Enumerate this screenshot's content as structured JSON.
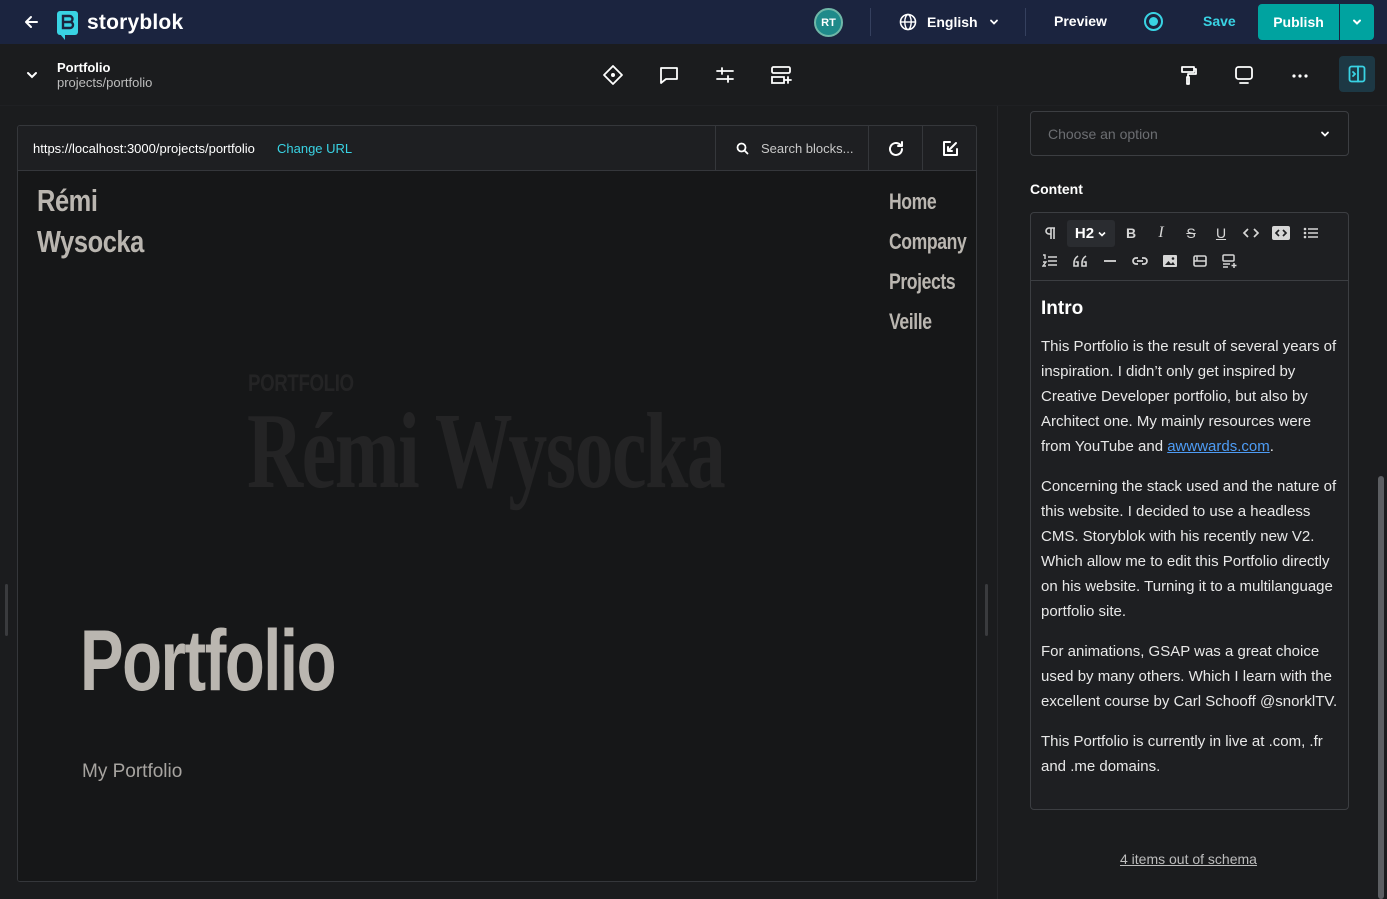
{
  "app": {
    "brand": "storyblok",
    "colors": {
      "topbar": "#1b243f",
      "accent": "#39d3e4",
      "publish": "#00a3a0",
      "link": "#4e9cf5"
    }
  },
  "topbar": {
    "back_icon": "arrow-left-icon",
    "avatar_initials": "RT",
    "language": "English",
    "preview_label": "Preview",
    "save_label": "Save",
    "publish_label": "Publish"
  },
  "story": {
    "name": "Portfolio",
    "slug": "projects/portfolio"
  },
  "toolbar_icons": [
    "diamond-icon",
    "comment-icon",
    "sliders-icon",
    "add-block-icon",
    "paint-roller-icon",
    "monitor-icon",
    "more-icon",
    "sidebar-toggle-icon"
  ],
  "preview": {
    "url": "https://localhost:3000/projects/portfolio",
    "change_url_label": "Change URL",
    "search_placeholder": "Search blocks..."
  },
  "site": {
    "logo_line1": "Rémi",
    "logo_line2": "Wysocka",
    "nav": [
      "Home",
      "Company",
      "Projects",
      "Veille"
    ],
    "ghost_small": "PORTFOLIO",
    "ghost_big": "Rémi Wysocka",
    "hero_title": "Portfolio",
    "hero_subtitle": "My Portfolio"
  },
  "sidebar": {
    "select_placeholder": "Choose an option",
    "content_label": "Content",
    "heading_level": "H2",
    "content": {
      "heading": "Intro",
      "p1_before": "This Portfolio is the result of several years of inspiration. I didn’t only get inspired by Creative Developer portfolio, but also by Architect one. My mainly resources were from YouTube and ",
      "p1_link": "awwwards.com",
      "p1_after": ".",
      "p2": "Concerning the stack used and the nature of this website. I decided to use a headless CMS. Storyblok with his recently new V2. Which allow me to edit this Portfolio directly on his website. Turning it to a multilanguage portfolio site.",
      "p3": "For animations, GSAP was a great choice used by many others. Which I learn with the excellent course by Carl Schooff @snorklTV.",
      "p4": "This Portfolio is currently in live at .com, .fr and .me domains."
    },
    "schema_link": "4 items out of schema"
  }
}
